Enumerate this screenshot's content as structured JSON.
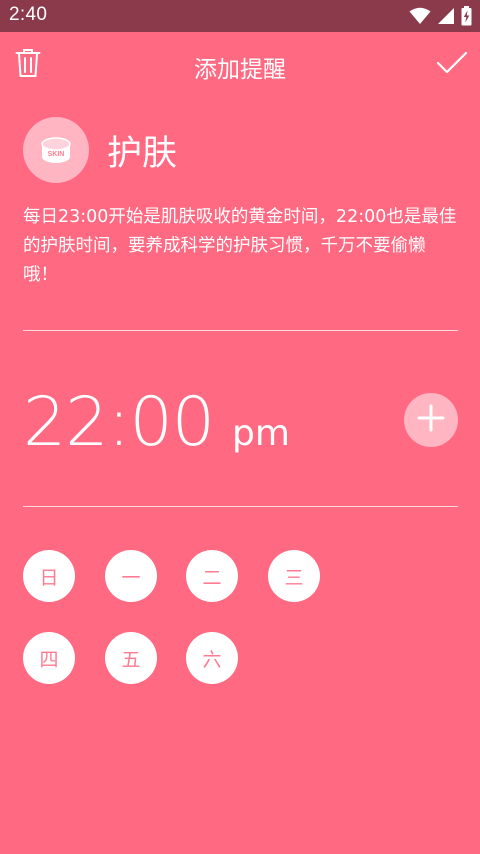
{
  "status_bar": {
    "time": "2:40",
    "icons": [
      "wifi-icon",
      "cellular-signal-icon",
      "battery-charging-icon"
    ]
  },
  "toolbar": {
    "title": "添加提醒",
    "left_icon": "trash-icon",
    "right_icon": "check-icon"
  },
  "reminder": {
    "avatar_label": "SKIN",
    "title": "护肤",
    "description": "每日23:00开始是肌肤吸收的黄金时间，22:00也是最佳的护肤时间，要养成科学的护肤习惯，千万不要偷懒哦！"
  },
  "time": {
    "value": "22:00",
    "period": "pm",
    "add_icon": "plus-icon"
  },
  "days": [
    {
      "label": "日"
    },
    {
      "label": "一"
    },
    {
      "label": "二"
    },
    {
      "label": "三"
    },
    {
      "label": "四"
    },
    {
      "label": "五"
    },
    {
      "label": "六"
    }
  ],
  "colors": {
    "background": "#ff6982",
    "status_bar": "#8a3a4a",
    "accent_light": "#ffb5c2",
    "day_text": "#ff7b92"
  }
}
